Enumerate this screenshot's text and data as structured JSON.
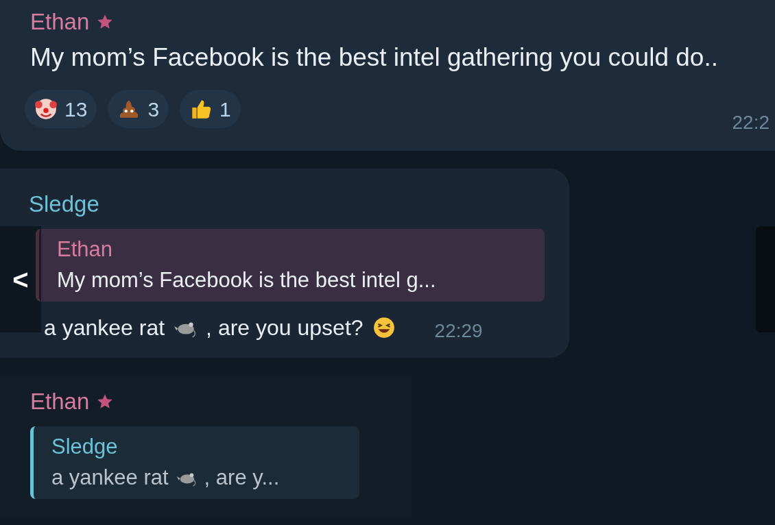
{
  "messages": [
    {
      "sender": "Ethan",
      "color": "#d77ba0",
      "premium": true,
      "text": "My mom’s Facebook is the best intel gathering you could do..",
      "reactions": [
        {
          "kind": "clown",
          "count": "13"
        },
        {
          "kind": "poop",
          "count": "3"
        },
        {
          "kind": "thumbs",
          "count": "1"
        }
      ],
      "time": "22:2"
    },
    {
      "sender": "Sledge",
      "color": "#6cc3d8",
      "premium": false,
      "reply": {
        "sender": "Ethan",
        "color": "#d77ba0",
        "parts": [
          {
            "kind": "text",
            "text": "My mom’s Facebook is the best intel g..."
          }
        ]
      },
      "parts": [
        {
          "kind": "text",
          "text": "a yankee rat"
        },
        {
          "kind": "rat"
        },
        {
          "kind": "text",
          "text": ", are you upset?"
        },
        {
          "kind": "laugh"
        }
      ],
      "time": "22:29"
    },
    {
      "sender": "Ethan",
      "color": "#d77ba0",
      "premium": true,
      "reply": {
        "sender": "Sledge",
        "color": "#6cc3d8",
        "parts": [
          {
            "kind": "text",
            "text": "a yankee rat"
          },
          {
            "kind": "rat"
          },
          {
            "kind": "text",
            "text": ", are y..."
          }
        ]
      }
    }
  ],
  "nav": {
    "back": "<"
  }
}
